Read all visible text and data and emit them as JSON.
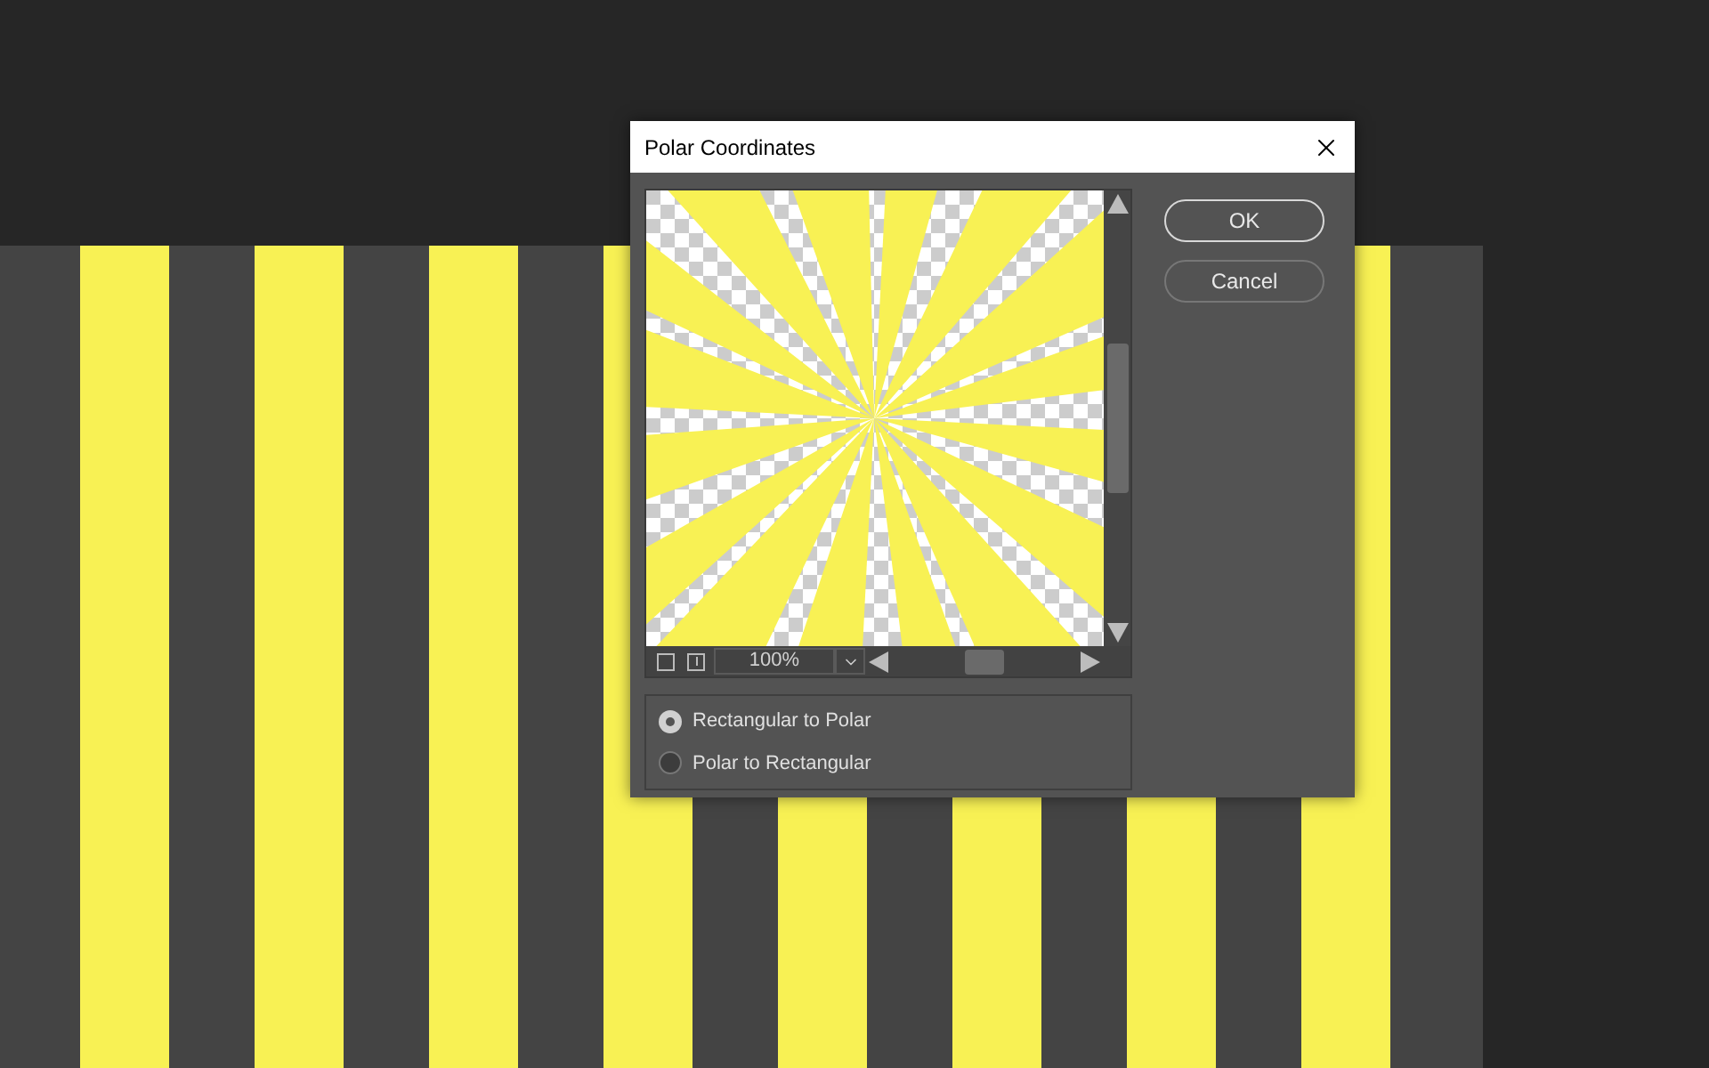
{
  "dialog": {
    "title": "Polar Coordinates",
    "zoom": "100%",
    "buttons": [
      {
        "label": "OK",
        "kind": "default"
      },
      {
        "label": "Cancel",
        "kind": "normal"
      }
    ],
    "options": [
      {
        "label": "Rectangular to Polar",
        "selected": true
      },
      {
        "label": "Polar to Rectangular",
        "selected": false
      }
    ]
  }
}
